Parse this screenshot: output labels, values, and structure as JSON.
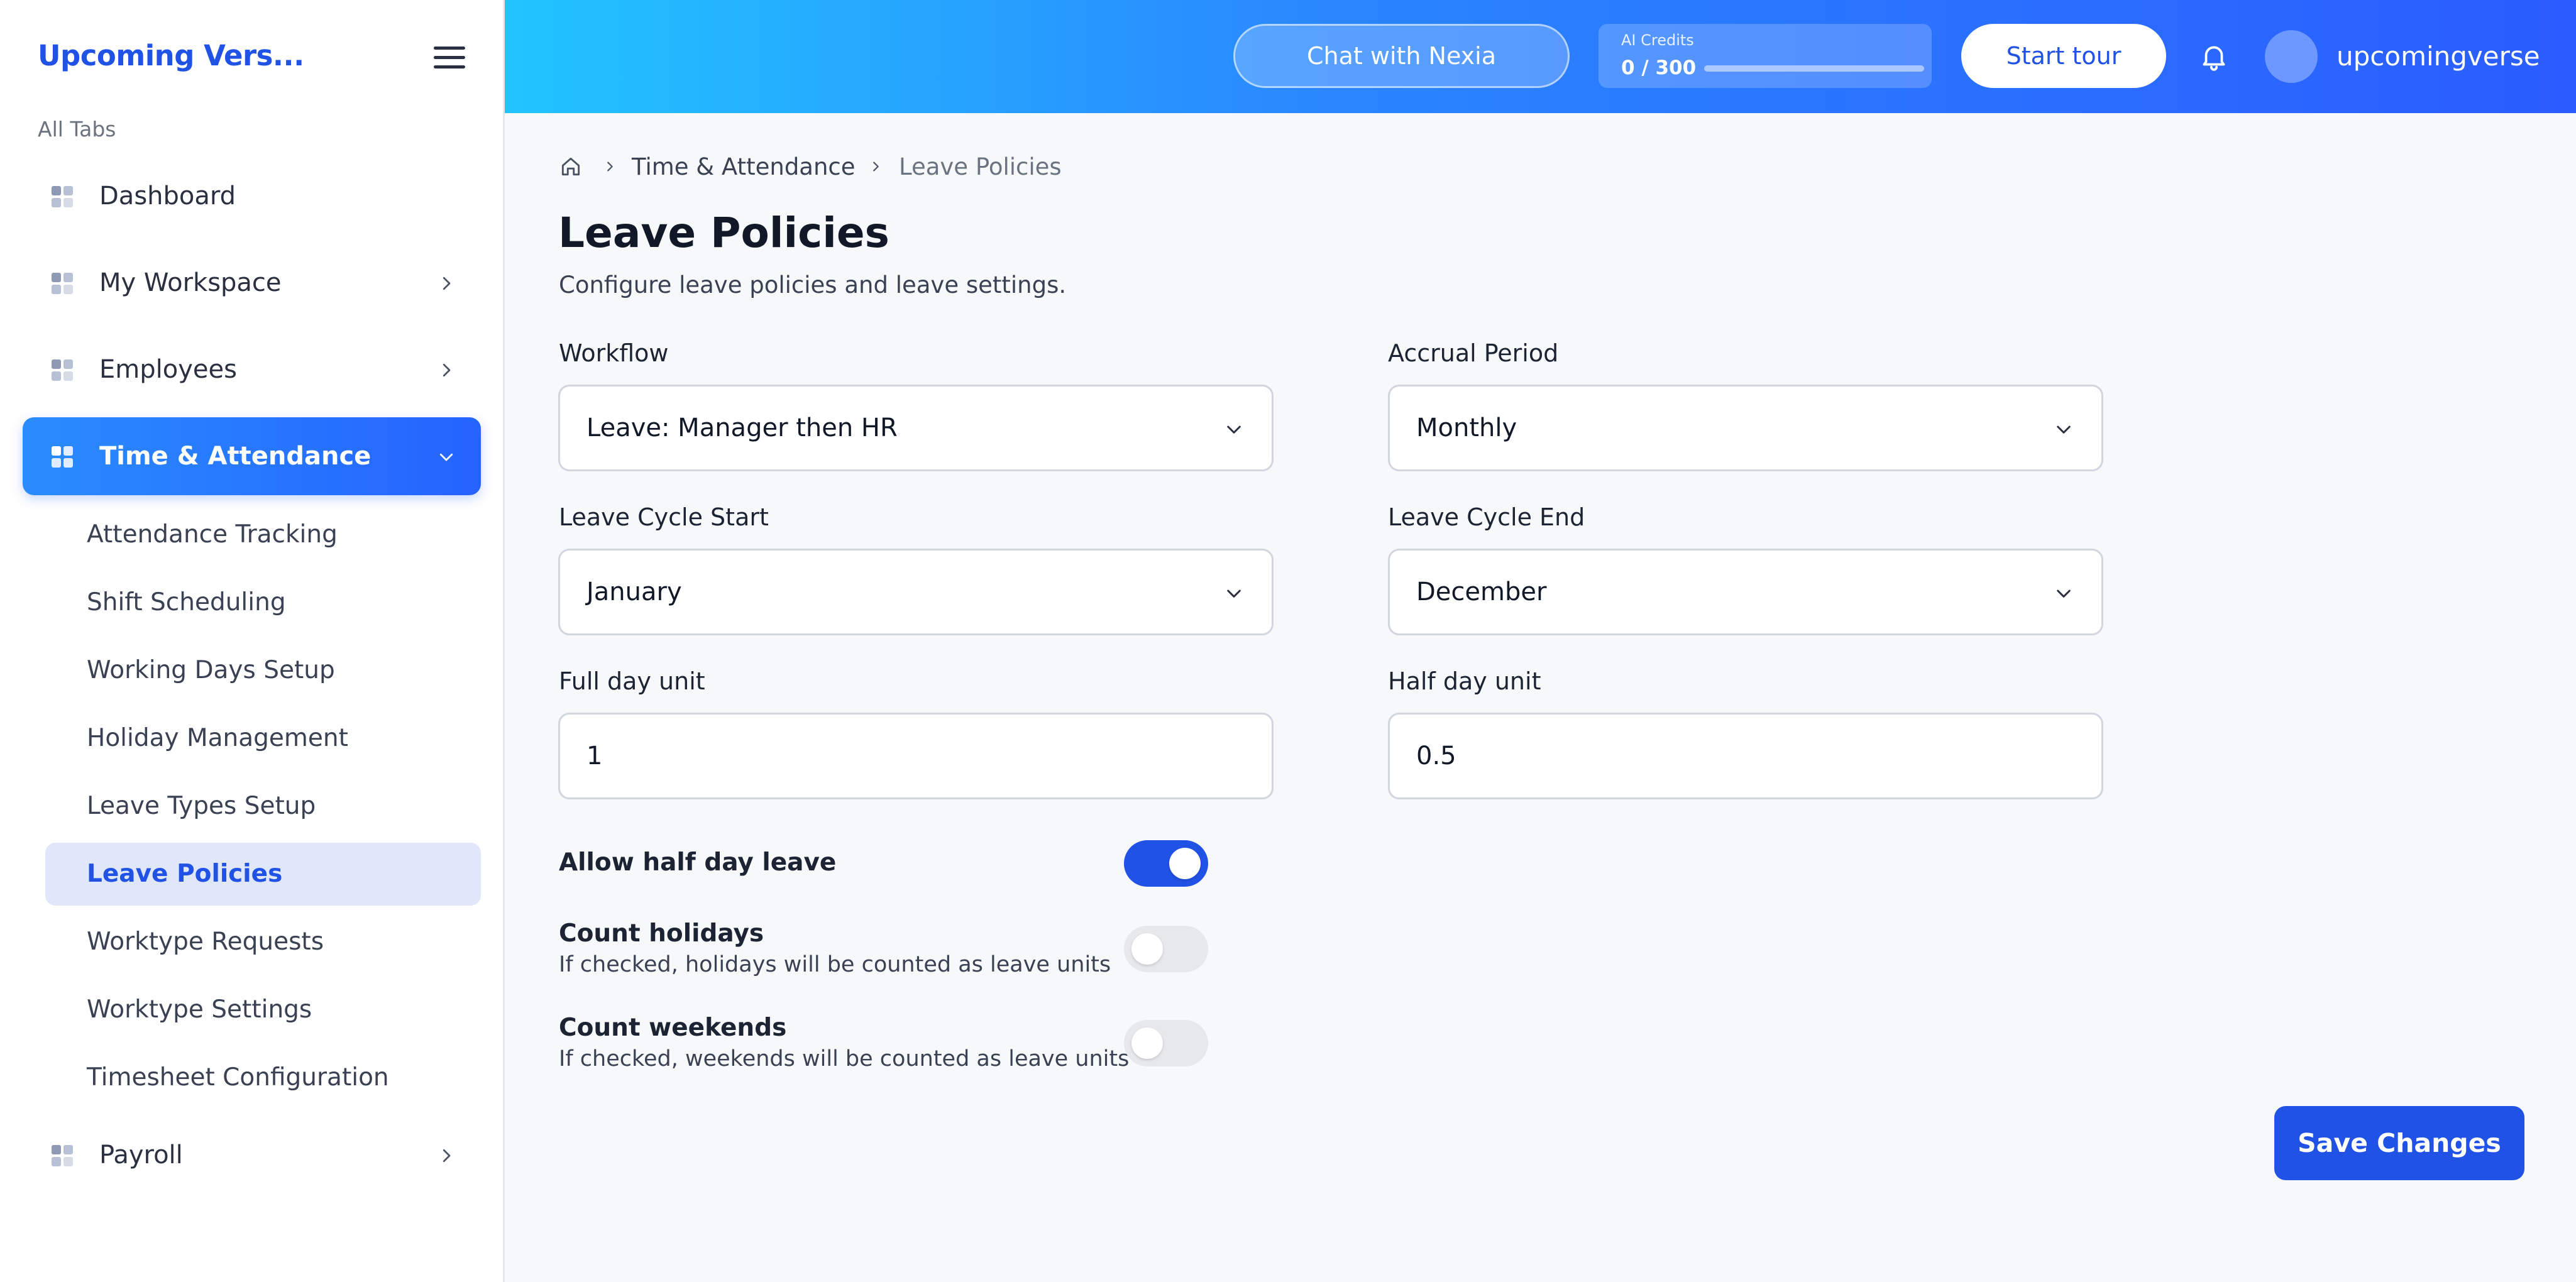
{
  "sidebar": {
    "brand": "Upcoming Vers...",
    "section_label": "All Tabs",
    "items": [
      {
        "label": "Dashboard"
      },
      {
        "label": "My Workspace"
      },
      {
        "label": "Employees"
      },
      {
        "label": "Time & Attendance"
      },
      {
        "label": "Payroll"
      }
    ],
    "sub_items": [
      {
        "label": "Attendance Tracking"
      },
      {
        "label": "Shift Scheduling"
      },
      {
        "label": "Working Days Setup"
      },
      {
        "label": "Holiday Management"
      },
      {
        "label": "Leave Types Setup"
      },
      {
        "label": "Leave Policies"
      },
      {
        "label": "Worktype Requests"
      },
      {
        "label": "Worktype Settings"
      },
      {
        "label": "Timesheet Configuration"
      }
    ]
  },
  "header": {
    "chat_label": "Chat with Nexia",
    "credits_title": "AI Credits",
    "credits_count": "0 / 300",
    "credits_used_fraction": 0,
    "tour_label": "Start tour",
    "username": "upcomingverse"
  },
  "breadcrumb": {
    "items": [
      "Time & Attendance",
      "Leave Policies"
    ]
  },
  "page": {
    "title": "Leave Policies",
    "subtitle": "Configure leave policies and leave settings."
  },
  "form": {
    "workflow": {
      "label": "Workflow",
      "value": "Leave: Manager then HR"
    },
    "accrual_period": {
      "label": "Accrual Period",
      "value": "Monthly"
    },
    "leave_cycle_start": {
      "label": "Leave Cycle Start",
      "value": "January"
    },
    "leave_cycle_end": {
      "label": "Leave Cycle End",
      "value": "December"
    },
    "full_day_unit": {
      "label": "Full day unit",
      "value": "1"
    },
    "half_day_unit": {
      "label": "Half day unit",
      "value": "0.5"
    },
    "toggles": [
      {
        "title": "Allow half day leave",
        "desc": "",
        "on": true
      },
      {
        "title": "Count holidays",
        "desc": "If checked, holidays will be counted as leave units",
        "on": false
      },
      {
        "title": "Count weekends",
        "desc": "If checked, weekends will be counted as leave units",
        "on": false
      }
    ],
    "save_label": "Save Changes"
  },
  "colors": {
    "accent": "#2152e6",
    "header_gradient_start": "#22c4ff",
    "header_gradient_end": "#2b5cff"
  }
}
